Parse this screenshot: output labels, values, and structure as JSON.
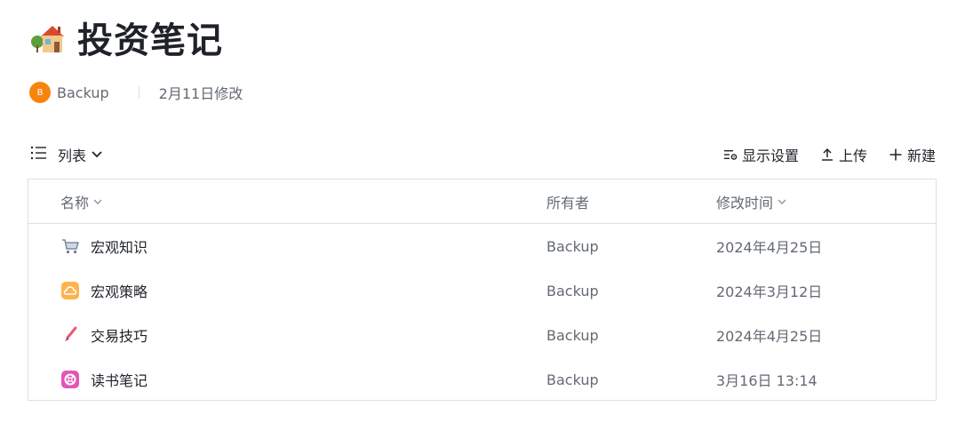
{
  "header": {
    "title": "投资笔记",
    "icon": "house-icon"
  },
  "meta": {
    "avatar_letter": "B",
    "owner": "Backup",
    "modified": "2月11日修改",
    "avatar_color": "#f7850d"
  },
  "toolbar": {
    "view_label": "列表",
    "display_settings_label": "显示设置",
    "upload_label": "上传",
    "new_label": "新建"
  },
  "table": {
    "columns": {
      "name": "名称",
      "owner": "所有者",
      "modified": "修改时间"
    },
    "rows": [
      {
        "icon": "shopping-cart-icon",
        "name": "宏观知识",
        "owner": "Backup",
        "modified": "2024年4月25日"
      },
      {
        "icon": "cloud-icon",
        "name": "宏观策略",
        "owner": "Backup",
        "modified": "2024年3月12日"
      },
      {
        "icon": "brush-icon",
        "name": "交易技巧",
        "owner": "Backup",
        "modified": "2024年4月25日"
      },
      {
        "icon": "lifebuoy-icon",
        "name": "读书笔记",
        "owner": "Backup",
        "modified": "3月16日 13:14"
      }
    ]
  }
}
